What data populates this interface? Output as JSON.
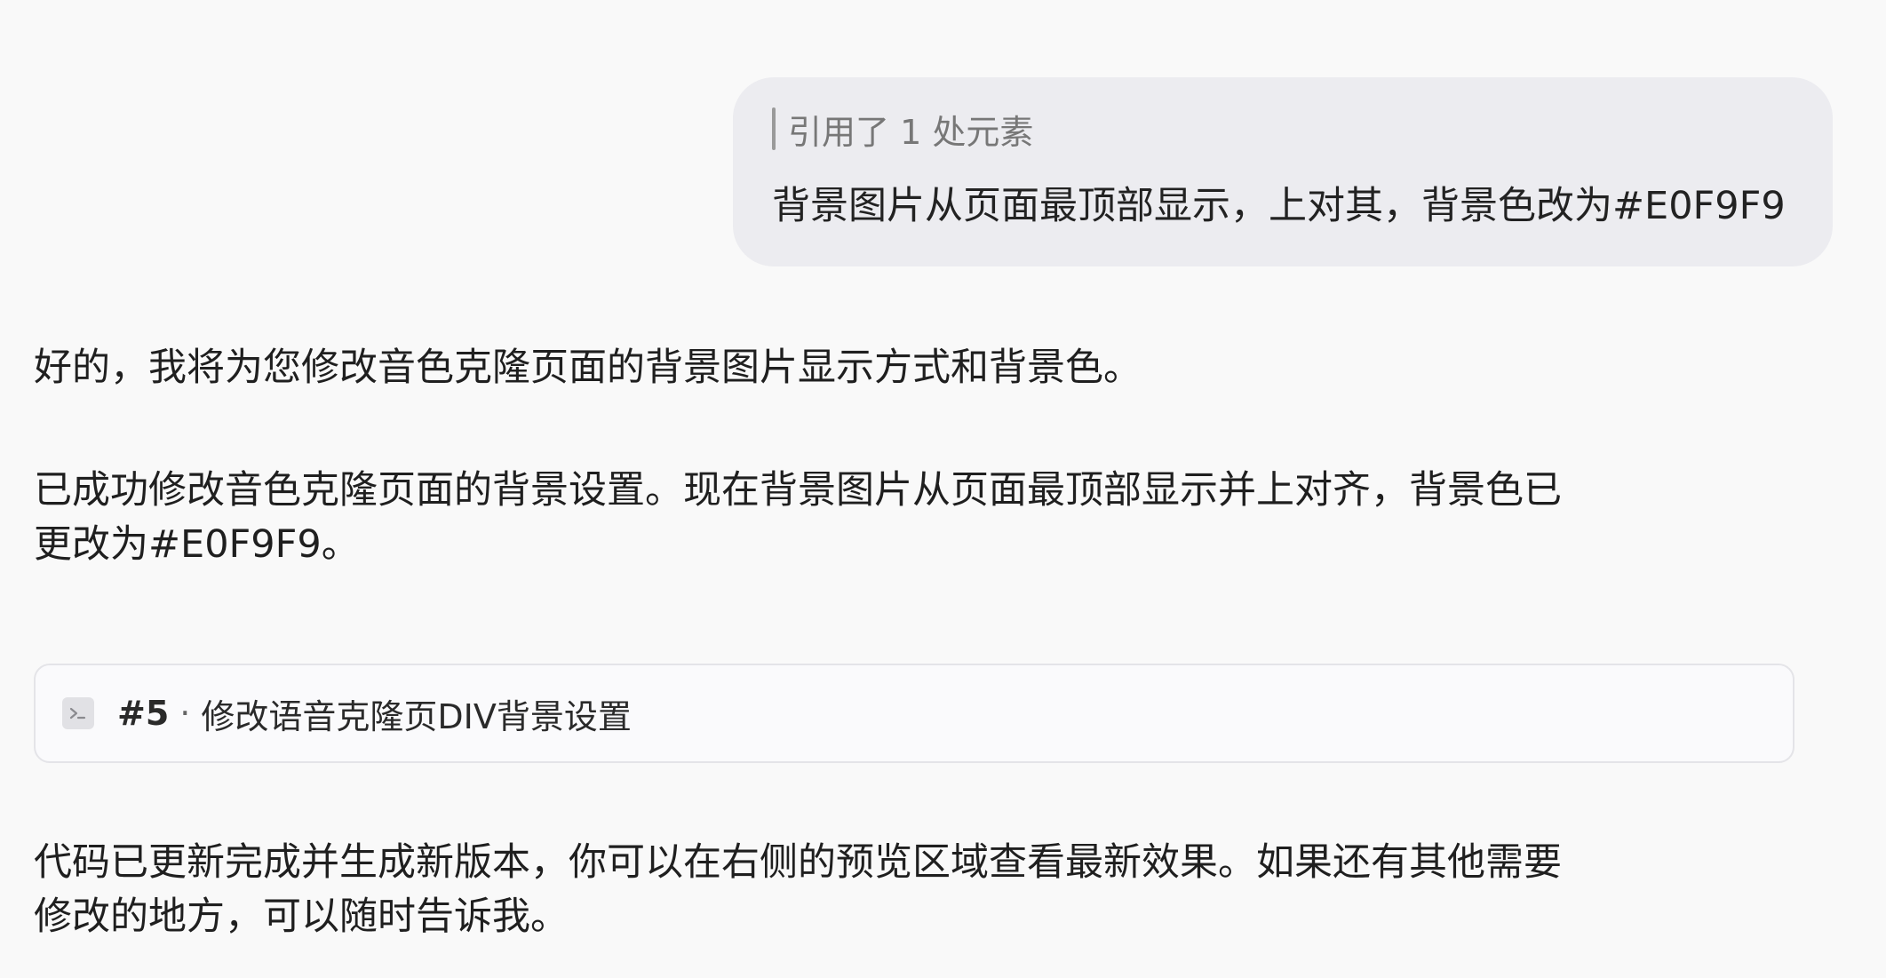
{
  "user_message": {
    "quote_reference": "引用了 1 处元素",
    "text": "背景图片从页面最顶部显示，上对其，背景色改为#E0F9F9"
  },
  "assistant": {
    "reply_1": "好的，我将为您修改音色克隆页面的背景图片显示方式和背景色。",
    "reply_2_line1": "已成功修改音色克隆页面的背景设置。现在背景图片从页面最顶部显示并上对齐，背景色已",
    "reply_2_line2": "更改为#E0F9F9。",
    "version_card": {
      "icon": "terminal-icon",
      "number": "#5",
      "separator": "·",
      "title": "修改语音克隆页DIV背景设置"
    },
    "reply_3_line1": "代码已更新完成并生成新版本，你可以在右侧的预览区域查看最新效果。如果还有其他需要",
    "reply_3_line2": "修改的地方，可以随时告诉我。"
  },
  "colors": {
    "page_background": "#f9f9f9",
    "user_bubble": "#ececf0",
    "card_border": "#e4e4e8"
  }
}
